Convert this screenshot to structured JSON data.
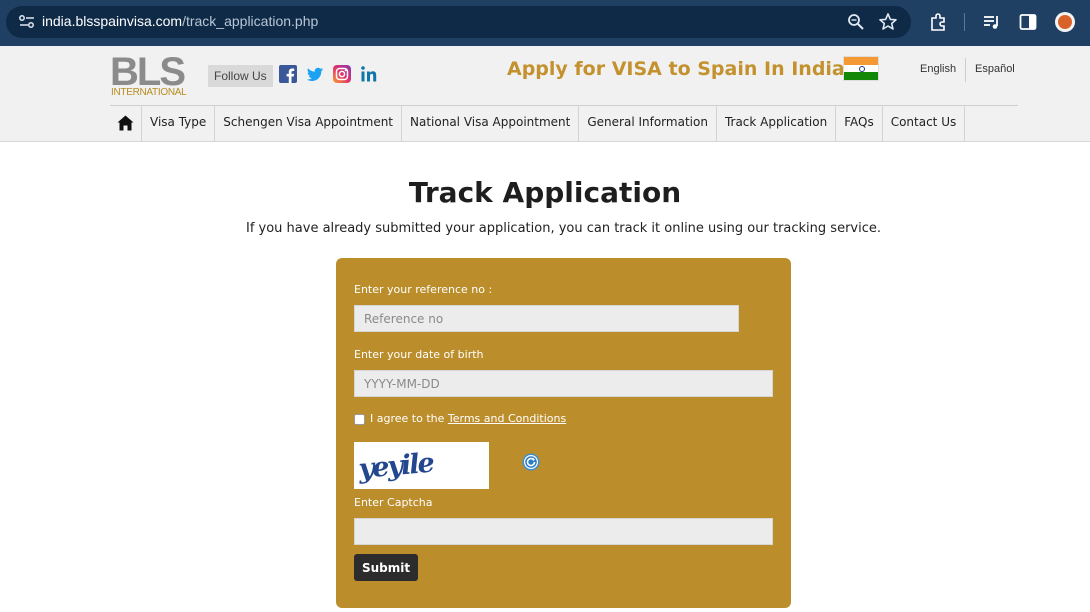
{
  "browser": {
    "url_host": "india.blsspainvisa.com",
    "url_path": "/track_application.php"
  },
  "header": {
    "logo_text": "BLS",
    "logo_subtext": "INTERNATIONAL",
    "follow_label": "Follow Us",
    "headline": "Apply for VISA to Spain In India",
    "languages": [
      "English",
      "Español"
    ]
  },
  "nav": {
    "items": [
      "Visa Type",
      "Schengen Visa Appointment",
      "National Visa Appointment",
      "General Information",
      "Track Application",
      "FAQs",
      "Contact Us"
    ]
  },
  "main": {
    "title": "Track Application",
    "intro": "If you have already submitted your application, you can track it online using our tracking service."
  },
  "form": {
    "reference_label": "Enter your reference no :",
    "reference_placeholder": "Reference no",
    "dob_label": "Enter your date of birth",
    "dob_placeholder": "YYYY-MM-DD",
    "agree_prefix": "I agree to the",
    "terms_link": "Terms and Conditions",
    "captcha_text": "yeyile",
    "captcha_label": "Enter Captcha",
    "submit_label": "Submit"
  },
  "colors": {
    "panel": "#bb8e2b",
    "headline": "#c3922e",
    "chrome": "#1f3f63"
  }
}
